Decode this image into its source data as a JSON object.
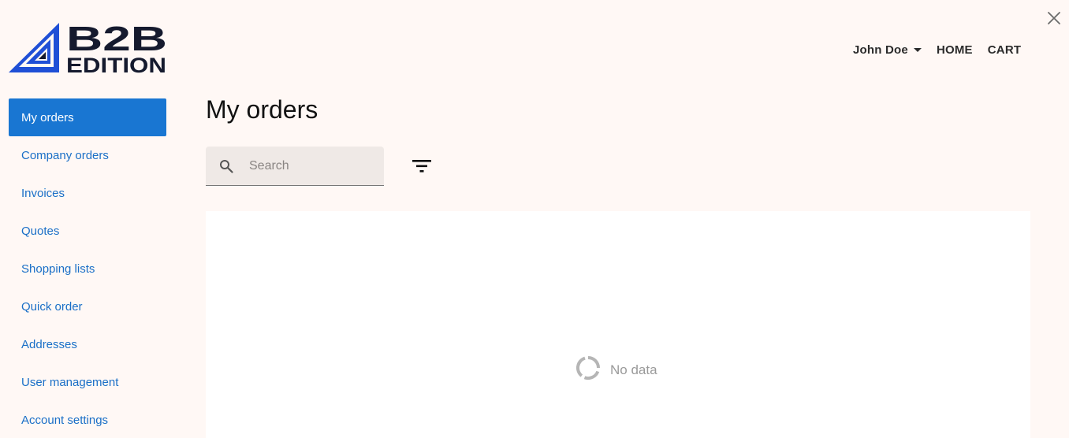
{
  "header": {
    "logo": {
      "line1": "B2B",
      "line2": "EDITION"
    },
    "nav": {
      "user_name": "John Doe",
      "home_label": "HOME",
      "cart_label": "CART"
    }
  },
  "sidebar": {
    "items": [
      {
        "label": "My orders",
        "active": true
      },
      {
        "label": "Company orders"
      },
      {
        "label": "Invoices"
      },
      {
        "label": "Quotes"
      },
      {
        "label": "Shopping lists"
      },
      {
        "label": "Quick order"
      },
      {
        "label": "Addresses"
      },
      {
        "label": "User management"
      },
      {
        "label": "Account settings"
      }
    ]
  },
  "main": {
    "title": "My orders",
    "search": {
      "placeholder": "Search",
      "value": ""
    },
    "table": {
      "empty_text": "No data"
    }
  },
  "colors": {
    "accent": "#1976d2",
    "link": "#1a6fc7",
    "background": "#fff8f5",
    "logo_blue": "#1f4fd6",
    "logo_dark": "#151a2e"
  },
  "icons": {
    "close": "close-icon",
    "search": "search-icon",
    "filter": "filter-icon",
    "spinner": "spinner-icon",
    "caret": "caret-down-icon"
  }
}
